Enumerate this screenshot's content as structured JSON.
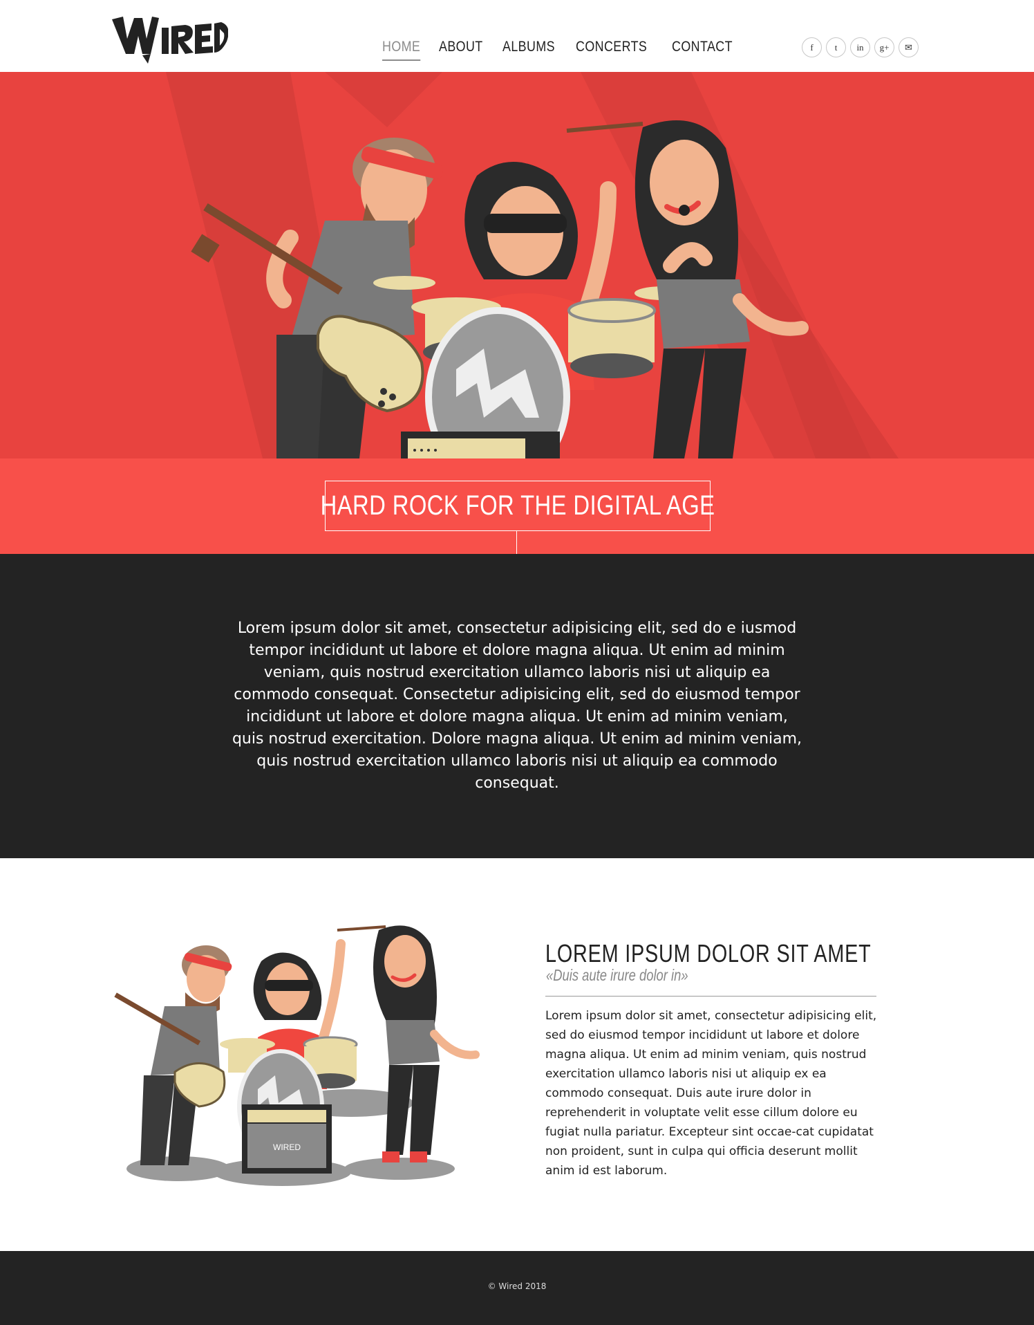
{
  "brand": {
    "logo_text": "WIRED"
  },
  "nav": {
    "items": [
      {
        "label": "HOME",
        "active": true
      },
      {
        "label": "ABOUT",
        "active": false
      },
      {
        "label": "ALBUMS",
        "active": false
      },
      {
        "label": "CONCERTS",
        "active": false
      },
      {
        "label": "CONTACT",
        "active": false
      }
    ]
  },
  "social": {
    "icons": [
      {
        "name": "facebook-icon",
        "glyph": "f"
      },
      {
        "name": "twitter-icon",
        "glyph": "t"
      },
      {
        "name": "linkedin-icon",
        "glyph": "in"
      },
      {
        "name": "google-plus-icon",
        "glyph": "g+"
      },
      {
        "name": "mail-icon",
        "glyph": "✉"
      }
    ]
  },
  "hero": {
    "tagline": "HARD ROCK FOR THE DIGITAL AGE"
  },
  "intro": {
    "text": "Lorem ipsum dolor sit amet, consectetur adipisicing elit, sed do e iusmod tempor incididunt ut labore et dolore magna aliqua. Ut enim ad minim veniam, quis nostrud exercitation ullamco laboris nisi ut aliquip ea commodo consequat. Consectetur adipisicing elit, sed do eiusmod tempor incididunt ut labore et dolore magna aliqua. Ut enim ad minim veniam, quis nostrud exercitation. Dolore magna aliqua. Ut enim ad minim veniam, quis nostrud exercitation ullamco laboris nisi ut aliquip ea commodo consequat."
  },
  "feature": {
    "title": "LOREM IPSUM DOLOR SIT AMET",
    "subtitle": "«Duis aute irure dolor in»",
    "body": "Lorem ipsum dolor sit amet, consectetur adipisicing elit, sed do eiusmod tempor incididunt ut labore et dolore magna aliqua. Ut enim ad minim veniam, quis nostrud exercitation ullamco laboris nisi ut aliquip ex ea commodo consequat. Duis aute irure dolor in reprehenderit in voluptate velit esse cillum dolore eu fugiat nulla pariatur. Excepteur sint occae-cat cupidatat non proident, sunt in culpa qui officia deserunt mollit anim id est laborum.",
    "amp_logo": "WIRED"
  },
  "footer": {
    "copyright": "© Wired 2018"
  },
  "colors": {
    "accent": "#f8504a",
    "hero_bg": "#e8433f",
    "dark": "#232323"
  }
}
